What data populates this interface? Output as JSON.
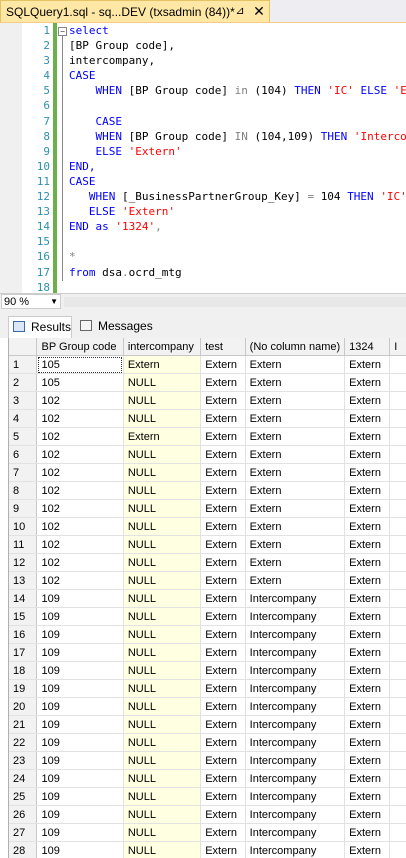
{
  "tab": {
    "title": "SQLQuery1.sql - sq...DEV (txsadmin (84))*",
    "pin_glyph": "⊿",
    "close_glyph": "✕"
  },
  "editor": {
    "line_numbers": [
      "1",
      "2",
      "3",
      "4",
      "5",
      "6",
      "7",
      "8",
      "9",
      "10",
      "11",
      "12",
      "13",
      "14",
      "15",
      "16",
      "17",
      "18"
    ],
    "lines": [
      [
        {
          "t": "select",
          "c": "kw"
        }
      ],
      [
        {
          "t": "[BP Group code],",
          "c": "pl"
        }
      ],
      [
        {
          "t": "intercompany,",
          "c": "pl"
        }
      ],
      [
        {
          "t": "CASE",
          "c": "kw"
        }
      ],
      [
        {
          "t": "    ",
          "c": "pl"
        },
        {
          "t": "WHEN ",
          "c": "kw"
        },
        {
          "t": "[BP Group code] ",
          "c": "pl"
        },
        {
          "t": "in ",
          "c": "gray"
        },
        {
          "t": "(104) ",
          "c": "pl"
        },
        {
          "t": "THEN ",
          "c": "kw"
        },
        {
          "t": "'IC' ",
          "c": "str"
        },
        {
          "t": "ELSE ",
          "c": "kw"
        },
        {
          "t": "'Extern'",
          "c": "str"
        }
      ],
      [
        {
          "t": "",
          "c": "pl"
        }
      ],
      [
        {
          "t": "    ",
          "c": "pl"
        },
        {
          "t": "CASE",
          "c": "kw"
        }
      ],
      [
        {
          "t": "    ",
          "c": "pl"
        },
        {
          "t": "WHEN ",
          "c": "kw"
        },
        {
          "t": "[BP Group code] ",
          "c": "pl"
        },
        {
          "t": "IN ",
          "c": "gray"
        },
        {
          "t": "(104,109) ",
          "c": "pl"
        },
        {
          "t": "THEN ",
          "c": "kw"
        },
        {
          "t": "'Intercompany'",
          "c": "str"
        }
      ],
      [
        {
          "t": "    ",
          "c": "pl"
        },
        {
          "t": "ELSE ",
          "c": "kw"
        },
        {
          "t": "'Extern'",
          "c": "str"
        }
      ],
      [
        {
          "t": "END,",
          "c": "kw"
        }
      ],
      [
        {
          "t": "CASE",
          "c": "kw"
        }
      ],
      [
        {
          "t": "   ",
          "c": "pl"
        },
        {
          "t": "WHEN ",
          "c": "kw"
        },
        {
          "t": "[_BusinessPartnerGroup_Key] ",
          "c": "pl"
        },
        {
          "t": "= ",
          "c": "gray"
        },
        {
          "t": "104 ",
          "c": "pl"
        },
        {
          "t": "THEN ",
          "c": "kw"
        },
        {
          "t": "'IC'",
          "c": "str"
        }
      ],
      [
        {
          "t": "   ",
          "c": "pl"
        },
        {
          "t": "ELSE ",
          "c": "kw"
        },
        {
          "t": "'Extern'",
          "c": "str"
        }
      ],
      [
        {
          "t": "END ",
          "c": "kw"
        },
        {
          "t": "as ",
          "c": "kw"
        },
        {
          "t": "'1324'",
          "c": "str"
        },
        {
          "t": ",",
          "c": "gray"
        }
      ],
      [
        {
          "t": "",
          "c": "pl"
        }
      ],
      [
        {
          "t": "*",
          "c": "gray"
        }
      ],
      [
        {
          "t": "from ",
          "c": "kw"
        },
        {
          "t": "dsa",
          "c": "pl"
        },
        {
          "t": ".",
          "c": "gray"
        },
        {
          "t": "ocrd_mtg",
          "c": "pl"
        }
      ],
      [
        {
          "t": "",
          "c": "pl"
        }
      ]
    ]
  },
  "zoom": {
    "value": "90 %",
    "arrow": "▼"
  },
  "results_tabs": {
    "results": "Results",
    "messages": "Messages"
  },
  "grid": {
    "columns": [
      "",
      "BP Group code",
      "intercompany",
      "test",
      "(No column name)",
      "1324",
      "I"
    ],
    "rows": [
      [
        "1",
        "105",
        "Extern",
        "Extern",
        "Extern",
        "Extern",
        ""
      ],
      [
        "2",
        "105",
        "NULL",
        "Extern",
        "Extern",
        "Extern",
        ""
      ],
      [
        "3",
        "102",
        "NULL",
        "Extern",
        "Extern",
        "Extern",
        ""
      ],
      [
        "4",
        "102",
        "NULL",
        "Extern",
        "Extern",
        "Extern",
        ""
      ],
      [
        "5",
        "102",
        "Extern",
        "Extern",
        "Extern",
        "Extern",
        ""
      ],
      [
        "6",
        "102",
        "NULL",
        "Extern",
        "Extern",
        "Extern",
        ""
      ],
      [
        "7",
        "102",
        "NULL",
        "Extern",
        "Extern",
        "Extern",
        ""
      ],
      [
        "8",
        "102",
        "NULL",
        "Extern",
        "Extern",
        "Extern",
        ""
      ],
      [
        "9",
        "102",
        "NULL",
        "Extern",
        "Extern",
        "Extern",
        ""
      ],
      [
        "10",
        "102",
        "NULL",
        "Extern",
        "Extern",
        "Extern",
        ""
      ],
      [
        "11",
        "102",
        "NULL",
        "Extern",
        "Extern",
        "Extern",
        ""
      ],
      [
        "12",
        "102",
        "NULL",
        "Extern",
        "Extern",
        "Extern",
        ""
      ],
      [
        "13",
        "102",
        "NULL",
        "Extern",
        "Extern",
        "Extern",
        ""
      ],
      [
        "14",
        "109",
        "NULL",
        "Extern",
        "Intercompany",
        "Extern",
        ""
      ],
      [
        "15",
        "109",
        "NULL",
        "Extern",
        "Intercompany",
        "Extern",
        ""
      ],
      [
        "16",
        "109",
        "NULL",
        "Extern",
        "Intercompany",
        "Extern",
        ""
      ],
      [
        "17",
        "109",
        "NULL",
        "Extern",
        "Intercompany",
        "Extern",
        ""
      ],
      [
        "18",
        "109",
        "NULL",
        "Extern",
        "Intercompany",
        "Extern",
        ""
      ],
      [
        "19",
        "109",
        "NULL",
        "Extern",
        "Intercompany",
        "Extern",
        ""
      ],
      [
        "20",
        "109",
        "NULL",
        "Extern",
        "Intercompany",
        "Extern",
        ""
      ],
      [
        "21",
        "109",
        "NULL",
        "Extern",
        "Intercompany",
        "Extern",
        ""
      ],
      [
        "22",
        "109",
        "NULL",
        "Extern",
        "Intercompany",
        "Extern",
        ""
      ],
      [
        "23",
        "109",
        "NULL",
        "Extern",
        "Intercompany",
        "Extern",
        ""
      ],
      [
        "24",
        "109",
        "NULL",
        "Extern",
        "Intercompany",
        "Extern",
        ""
      ],
      [
        "25",
        "109",
        "NULL",
        "Extern",
        "Intercompany",
        "Extern",
        ""
      ],
      [
        "26",
        "109",
        "NULL",
        "Extern",
        "Intercompany",
        "Extern",
        ""
      ],
      [
        "27",
        "109",
        "NULL",
        "Extern",
        "Intercompany",
        "Extern",
        ""
      ],
      [
        "28",
        "109",
        "NULL",
        "Extern",
        "Intercompany",
        "Extern",
        ""
      ]
    ]
  },
  "colors": {
    "tab_active": "#ffe8a6",
    "change_bar": "#6ab14a",
    "highlight_column": "#ffffe1",
    "keyword": "#0000ff",
    "string": "#ff0000"
  }
}
